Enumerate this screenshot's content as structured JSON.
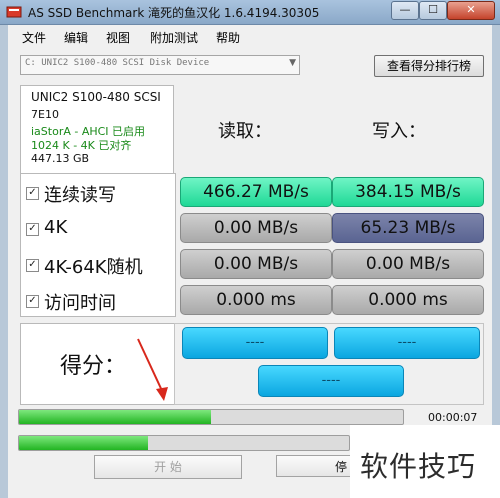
{
  "window": {
    "title": "AS SSD Benchmark 滝死的鱼汉化 1.6.4194.30305",
    "min": "—",
    "max": "☐",
    "close": "✕"
  },
  "menu": [
    "文件",
    "编辑",
    "视图",
    "附加测试",
    "帮助"
  ],
  "device": {
    "selected": "C: UNIC2 S100-480 SCSI Disk Device"
  },
  "rank_button": "查看得分排行榜",
  "info": {
    "model": "UNIC2 S100-480 SCSI",
    "firmware": "7E10",
    "driver": "iaStorA - AHCI 已启用",
    "alignment": "1024 K - 4K 已对齐",
    "capacity": "447.13 GB"
  },
  "headers": {
    "read": "读取：",
    "write": "写入："
  },
  "rows": [
    {
      "label": "连续读写",
      "read": "466.27 MB/s",
      "write": "384.15 MB/s",
      "checked": true
    },
    {
      "label": "4K",
      "read": "0.00 MB/s",
      "write": "65.23 MB/s",
      "checked": true
    },
    {
      "label": "4K-64K随机",
      "read": "0.00 MB/s",
      "write": "0.00 MB/s",
      "checked": true
    },
    {
      "label": "访问时间",
      "read": "0.000 ms",
      "write": "0.000 ms",
      "checked": true
    }
  ],
  "score": {
    "label": "得分：",
    "read": "----",
    "write": "----",
    "total": "----"
  },
  "progress": {
    "bar1": 0.5,
    "bar2": 0.39,
    "time": "00:00:07"
  },
  "buttons": {
    "start": "开 始",
    "stop": "停"
  },
  "watermark": "软件技巧",
  "colors": {
    "green": "#1fd896",
    "grey": "#a9a9a9",
    "blue_write": "#5a6492",
    "score": "#0aa6e0",
    "arrow": "#d8281c"
  }
}
